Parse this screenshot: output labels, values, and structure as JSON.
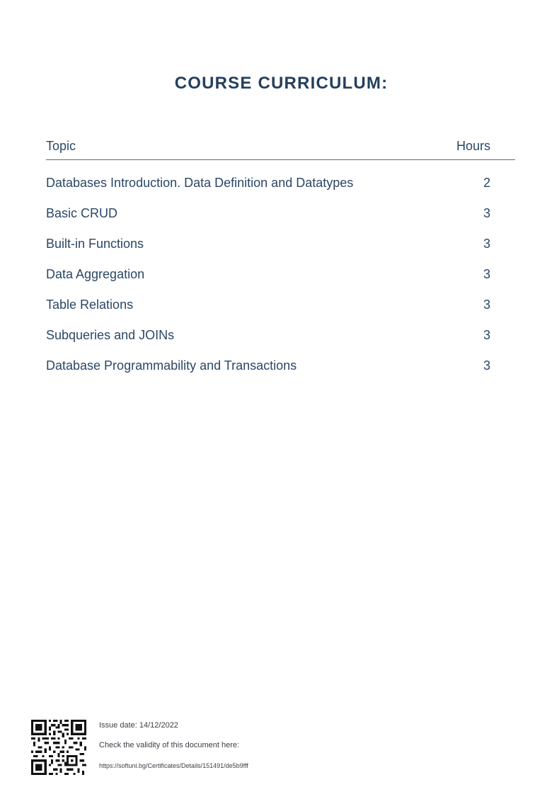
{
  "title": "COURSE CURRICULUM:",
  "table": {
    "headers": {
      "topic": "Topic",
      "hours": "Hours"
    },
    "rows": [
      {
        "topic": "Databases Introduction. Data Definition and Datatypes",
        "hours": "2"
      },
      {
        "topic": "Basic CRUD",
        "hours": "3"
      },
      {
        "topic": "Built-in Functions",
        "hours": "3"
      },
      {
        "topic": "Data Aggregation",
        "hours": "3"
      },
      {
        "topic": "Table Relations",
        "hours": "3"
      },
      {
        "topic": "Subqueries and JOINs",
        "hours": "3"
      },
      {
        "topic": "Database Programmability and Transactions",
        "hours": "3"
      }
    ]
  },
  "footer": {
    "qr_icon": "qr-code-icon",
    "issue_date": "Issue date: 14/12/2022",
    "validity_text": "Check the validity of this document here:",
    "url": "https://softuni.bg/Certificates/Details/151491/de5b9fff"
  },
  "colors": {
    "title": "#243f5e",
    "text": "#2b4766",
    "rule": "#5b6b7c"
  }
}
